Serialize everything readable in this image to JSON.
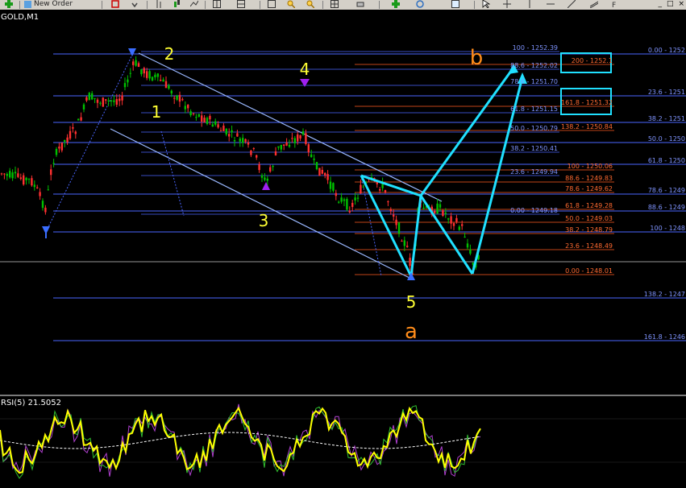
{
  "toolbar": {
    "new_order_label": "New Order",
    "icons": [
      "new-chart-icon",
      "new-order-icon",
      "print-icon",
      "favorites-icon",
      "autotrading-icon",
      "zoom-in-icon",
      "zoom-out-icon",
      "chart-bars-icon",
      "indicators-icon",
      "period-icon",
      "crosshair-icon",
      "cursor-icon",
      "fibo-icon",
      "template-icon"
    ]
  },
  "window_controls": [
    "_",
    "□",
    "×"
  ],
  "chart": {
    "symbol_label": "GOLD,M1",
    "colors": {
      "bull": "#00c000",
      "bear": "#ff3030",
      "fib_blue": "#4a66ff",
      "fib_red": "#ff5a20",
      "cyan": "#20e0ff",
      "channel": "#9ab8ff",
      "wave_label": "#ffff33",
      "abc_label": "#ff8c1a",
      "marker_blue": "#3a6dff",
      "marker_purple": "#a020f0"
    },
    "wave_labels": [
      "1",
      "2",
      "3",
      "4",
      "5"
    ],
    "abc_labels": [
      "a",
      "b"
    ],
    "right_fib_levels": [
      "0.00 - 1252",
      "23.6 - 1251",
      "38.2 - 1251",
      "50.0 - 1250",
      "61.8 - 1250",
      "78.6 - 1249",
      "88.6 - 1249",
      "100 - 1248",
      "138.2 - 1247",
      "161.8 - 1246"
    ],
    "mid_fib_blue": [
      "100 - 1252.39",
      "88.6 - 1252.02",
      "78.6 - 1251.70",
      "61.8 - 1251.15",
      "50.0 - 1250.79",
      "38.2 - 1250.41",
      "23.6 - 1249.94",
      "0.00 - 1249.18"
    ],
    "mid_fib_red": [
      "200 - 1252.1",
      "161.8 - 1251.32",
      "138.2 - 1250.84",
      "100 - 1250.06",
      "88.6 - 1249.83",
      "78.6 - 1249.62",
      "61.8 - 1249.28",
      "50.0 - 1249.03",
      "38.2 - 1248.79",
      "23.6 - 1248.49",
      "0.00 - 1248.01"
    ]
  },
  "rsi": {
    "label": "RSI(5) 21.5052"
  }
}
